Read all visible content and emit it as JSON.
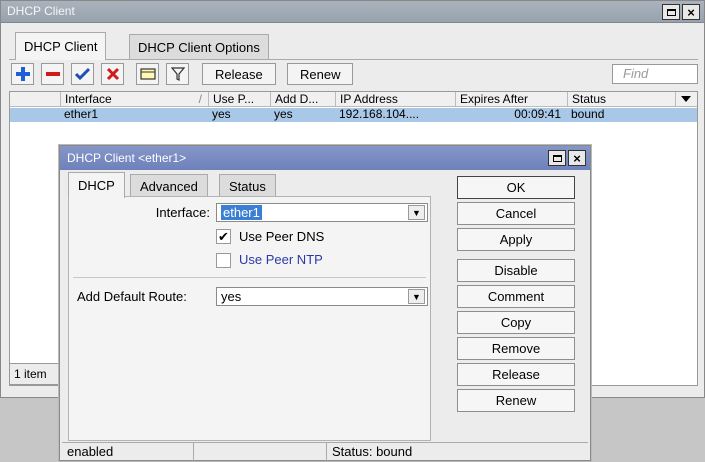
{
  "main_window": {
    "title": "DHCP Client",
    "tabs": [
      {
        "label": "DHCP Client"
      },
      {
        "label": "DHCP Client Options"
      }
    ],
    "toolbar": {
      "release_label": "Release",
      "renew_label": "Renew",
      "find_placeholder": "Find"
    },
    "table": {
      "columns": [
        "Interface",
        "Use P...",
        "Add D...",
        "IP Address",
        "Expires After",
        "Status"
      ],
      "sort_indicator": "/",
      "rows": [
        {
          "interface": "ether1",
          "use_peer": "yes",
          "add_default": "yes",
          "ip_address": "192.168.104....",
          "expires_after": "00:09:41",
          "status": "bound"
        }
      ]
    },
    "item_count": "1 item"
  },
  "dialog": {
    "title": "DHCP Client <ether1>",
    "tabs": [
      {
        "label": "DHCP"
      },
      {
        "label": "Advanced"
      },
      {
        "label": "Status"
      }
    ],
    "form": {
      "interface_label": "Interface:",
      "interface_value": "ether1",
      "use_peer_dns_label": "Use Peer DNS",
      "use_peer_dns_checked": true,
      "use_peer_ntp_label": "Use Peer NTP",
      "use_peer_ntp_checked": false,
      "add_default_route_label": "Add Default Route:",
      "add_default_route_value": "yes"
    },
    "buttons": {
      "ok": "OK",
      "cancel": "Cancel",
      "apply": "Apply",
      "disable": "Disable",
      "comment": "Comment",
      "copy": "Copy",
      "remove": "Remove",
      "release": "Release",
      "renew": "Renew"
    },
    "statusbar": {
      "state": "enabled",
      "middle": "",
      "status": "Status: bound"
    }
  },
  "colors": {
    "add_icon": "#1f5fd6",
    "remove_icon": "#d11b1b",
    "enable_icon": "#1f4fb5",
    "disable_icon": "#d11b1b",
    "selected_row": "#a9c8e7",
    "ntp_label": "#2a3aa8",
    "dialog_title": "#7687c2"
  }
}
